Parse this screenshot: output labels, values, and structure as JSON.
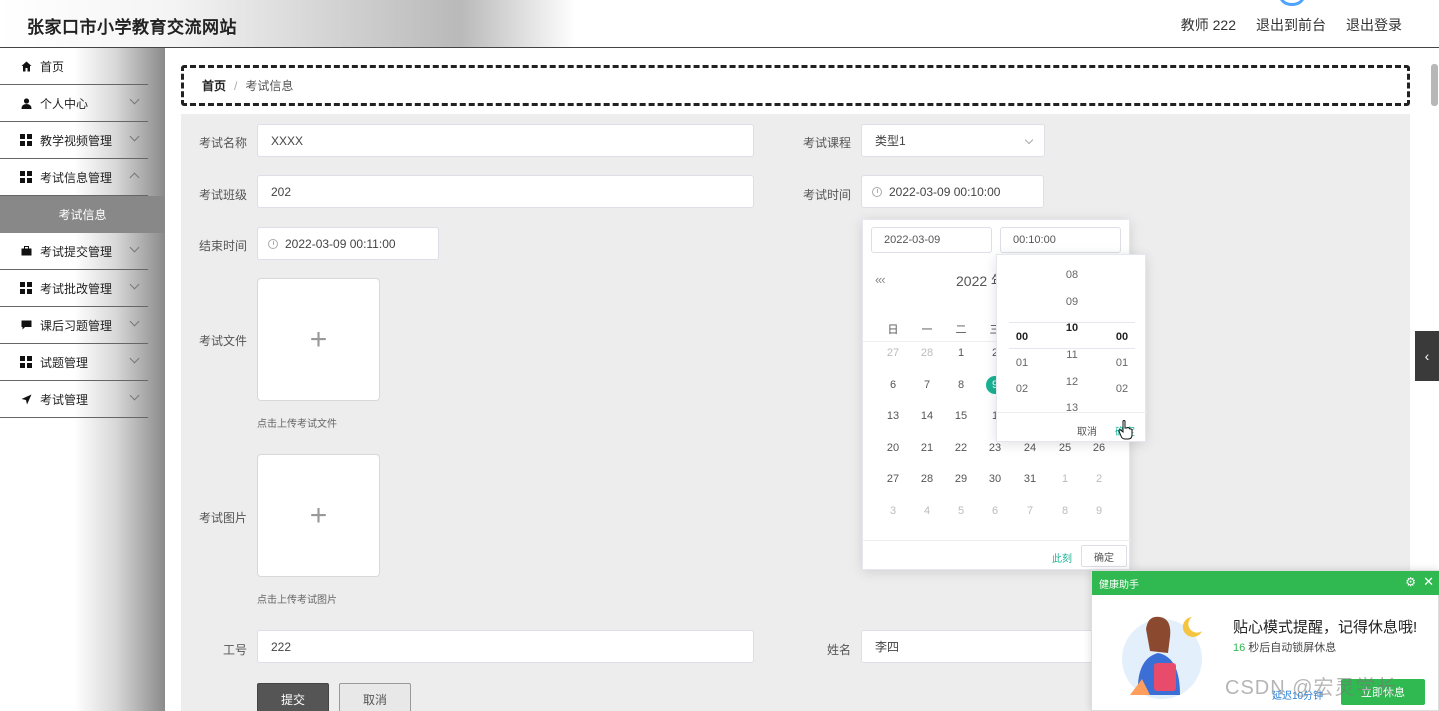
{
  "header": {
    "site_title": "张家口市小学教育交流网站",
    "user_label": "教师 222",
    "back_to_front": "退出到前台",
    "logout": "退出登录"
  },
  "sidebar": {
    "items": [
      {
        "label": "首页",
        "icon": "home-icon"
      },
      {
        "label": "个人中心",
        "icon": "user-icon"
      },
      {
        "label": "教学视频管理",
        "icon": "grid-icon"
      },
      {
        "label": "考试信息管理",
        "icon": "grid-icon"
      },
      {
        "label": "考试提交管理",
        "icon": "briefcase-icon"
      },
      {
        "label": "考试批改管理",
        "icon": "grid-icon"
      },
      {
        "label": "课后习题管理",
        "icon": "comment-icon"
      },
      {
        "label": "试题管理",
        "icon": "grid-icon"
      },
      {
        "label": "考试管理",
        "icon": "send-icon"
      }
    ],
    "active_sub": "考试信息"
  },
  "breadcrumb": {
    "home": "首页",
    "separator": "/",
    "current": "考试信息"
  },
  "form": {
    "exam_name_label": "考试名称",
    "exam_name_value": "XXXX",
    "exam_course_label": "考试课程",
    "exam_course_value": "类型1",
    "exam_class_label": "考试班级",
    "exam_class_value": "202",
    "exam_time_label": "考试时间",
    "exam_time_value": "2022-03-09 00:10:00",
    "end_time_label": "结束时间",
    "end_time_value": "2022-03-09 00:11:00",
    "exam_file_label": "考试文件",
    "exam_file_hint": "点击上传考试文件",
    "exam_image_label": "考试图片",
    "exam_image_hint": "点击上传考试图片",
    "upload_plus": "+",
    "job_no_label": "工号",
    "job_no_value": "222",
    "name_label": "姓名",
    "name_value": "李四",
    "submit": "提交",
    "cancel": "取消"
  },
  "date_picker": {
    "date_input": "2022-03-09",
    "time_input": "00:10:00",
    "nav_prev": "«‹",
    "year_label": "2022 年",
    "weekdays": [
      "日",
      "一",
      "二",
      "三"
    ],
    "rows": [
      [
        "27",
        "28",
        "1",
        "2"
      ],
      [
        "6",
        "7",
        "8",
        "9"
      ],
      [
        "13",
        "14",
        "15",
        "1"
      ],
      [
        "20",
        "21",
        "22",
        "23",
        "24",
        "25",
        "26"
      ],
      [
        "27",
        "28",
        "29",
        "30",
        "31",
        "1",
        "2"
      ],
      [
        "3",
        "4",
        "5",
        "6",
        "7",
        "8",
        "9"
      ]
    ],
    "now": "此刻",
    "confirm": "确定"
  },
  "time_spinner": {
    "hours": [
      "08",
      "09",
      "10",
      "11",
      "12",
      "13"
    ],
    "selected_hour": "10",
    "minutes": [
      "00",
      "01",
      "02"
    ],
    "seconds": [
      "00",
      "01",
      "02"
    ],
    "cancel": "取消",
    "confirm": "确定"
  },
  "health_popup": {
    "title": "健康助手",
    "message": "贴心模式提醒，记得休息哦!",
    "countdown": "16",
    "countdown_suffix": "秒后自动锁屏休息",
    "delay": "延迟10分钟",
    "action": "立即休息",
    "accent": "#2fb950"
  },
  "watermark": "CSDN @宏灵学长",
  "colors": {
    "accent_green": "#1ab394",
    "sidebar_active": "#888888"
  }
}
